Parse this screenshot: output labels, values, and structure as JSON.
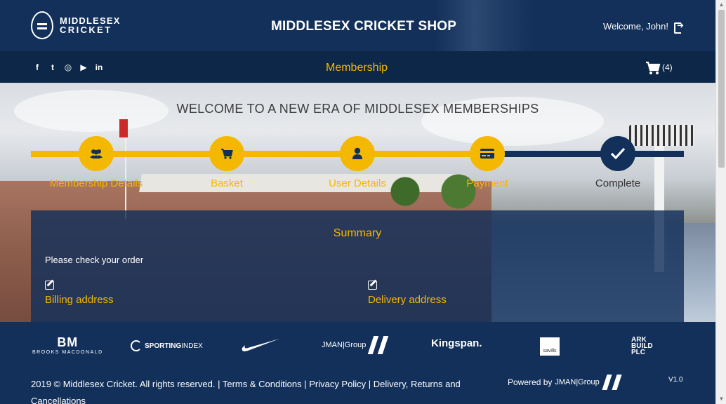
{
  "header": {
    "logo_line1": "MIDDLESEX",
    "logo_line2": "CRICKET",
    "title": "MIDDLESEX CRICKET SHOP",
    "welcome": "Welcome, John!"
  },
  "nav": {
    "socials": [
      "f",
      "t",
      "◎",
      "▶",
      "in"
    ],
    "membership": "Membership",
    "cart_count": "(4)"
  },
  "hero": {
    "heading": "WELCOME TO A NEW ERA OF MIDDLESEX MEMBERSHIPS",
    "steps": [
      {
        "label": "Membership Details",
        "icon": "users-icon",
        "state": "done"
      },
      {
        "label": "Basket",
        "icon": "cart-icon",
        "state": "done"
      },
      {
        "label": "User Details",
        "icon": "user-icon",
        "state": "done"
      },
      {
        "label": "Payment",
        "icon": "card-icon",
        "state": "done"
      },
      {
        "label": "Complete",
        "icon": "check-icon",
        "state": "current"
      }
    ]
  },
  "summary": {
    "title": "Summary",
    "instruction": "Please check your order",
    "billing_label": "Billing address",
    "delivery_label": "Delivery address"
  },
  "sponsors": {
    "bm_big": "BM",
    "bm_small": "BROOKS MACDONALD",
    "sporting_a": "SPORTING",
    "sporting_b": "INDEX",
    "jman": "JMAN|Group",
    "kingspan": "Kingspan.",
    "savills": "savills",
    "ark": [
      "ARK",
      "BUILD",
      "PLC"
    ]
  },
  "footer": {
    "copyright": "2019 © Middlesex Cricket. All rights reserved.",
    "terms": "Terms & Conditions",
    "privacy": "Privacy Policy",
    "delivery": "Delivery, Returns and Cancellations",
    "powered_by": "Powered by",
    "powered_brand": "JMAN|Group",
    "version": "V1.0"
  },
  "colors": {
    "navy": "#12305a",
    "accent": "#f5b800"
  }
}
